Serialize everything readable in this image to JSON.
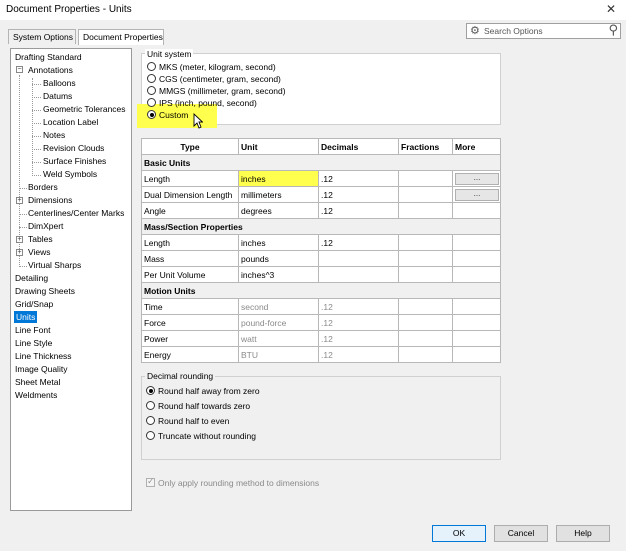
{
  "window": {
    "title": "Document Properties - Units",
    "close_glyph": "✕"
  },
  "tabs": [
    {
      "label": "System Options",
      "active": false
    },
    {
      "label": "Document Properties",
      "active": true
    }
  ],
  "search": {
    "placeholder": "Search Options",
    "icon": "gear-icon",
    "button_icon": "magnifier-icon"
  },
  "tree": {
    "items": [
      {
        "label": "Drafting Standard"
      },
      {
        "label": "Annotations",
        "expander": "−"
      },
      {
        "label": "Balloons"
      },
      {
        "label": "Datums"
      },
      {
        "label": "Geometric Tolerances"
      },
      {
        "label": "Location Label"
      },
      {
        "label": "Notes"
      },
      {
        "label": "Revision Clouds"
      },
      {
        "label": "Surface Finishes"
      },
      {
        "label": "Weld Symbols"
      },
      {
        "label": "Borders"
      },
      {
        "label": "Dimensions",
        "expander": "+"
      },
      {
        "label": "Centerlines/Center Marks"
      },
      {
        "label": "DimXpert"
      },
      {
        "label": "Tables",
        "expander": "+"
      },
      {
        "label": "Views",
        "expander": "+"
      },
      {
        "label": "Virtual Sharps"
      },
      {
        "label": "Detailing"
      },
      {
        "label": "Drawing Sheets"
      },
      {
        "label": "Grid/Snap"
      },
      {
        "label": "Units",
        "selected": true
      },
      {
        "label": "Line Font"
      },
      {
        "label": "Line Style"
      },
      {
        "label": "Line Thickness"
      },
      {
        "label": "Image Quality"
      },
      {
        "label": "Sheet Metal"
      },
      {
        "label": "Weldments"
      }
    ]
  },
  "unit_system": {
    "label": "Unit system",
    "options": [
      {
        "label": "MKS  (meter, kilogram, second)",
        "selected": false
      },
      {
        "label": "CGS  (centimeter, gram, second)",
        "selected": false
      },
      {
        "label": "MMGS  (millimeter, gram, second)",
        "selected": false
      },
      {
        "label": "IPS  (inch, pound, second)",
        "selected": false
      },
      {
        "label": "Custom",
        "selected": true
      }
    ],
    "highlight_color": "#ffff4d"
  },
  "units_table": {
    "headers": [
      "Type",
      "Unit",
      "Decimals",
      "Fractions",
      "More"
    ],
    "sections": [
      {
        "title": "Basic Units",
        "rows": [
          {
            "type": "Length",
            "unit": "inches",
            "decimals": ".12",
            "fractions": "",
            "more": "...",
            "highlight": true
          },
          {
            "type": "Dual Dimension Length",
            "unit": "millimeters",
            "decimals": ".12",
            "fractions": "",
            "more": "..."
          },
          {
            "type": "Angle",
            "unit": "degrees",
            "decimals": ".12",
            "fractions": "",
            "more": ""
          }
        ]
      },
      {
        "title": "Mass/Section Properties",
        "rows": [
          {
            "type": "Length",
            "unit": "inches",
            "decimals": ".12",
            "fractions": "",
            "more": ""
          },
          {
            "type": "Mass",
            "unit": "pounds",
            "decimals": "",
            "fractions": "",
            "more": ""
          },
          {
            "type": "Per Unit Volume",
            "unit": "inches^3",
            "decimals": "",
            "fractions": "",
            "more": ""
          }
        ]
      },
      {
        "title": "Motion Units",
        "rows": [
          {
            "type": "Time",
            "unit": "second",
            "decimals": ".12",
            "fractions": "",
            "more": "",
            "disabled": true
          },
          {
            "type": "Force",
            "unit": "pound-force",
            "decimals": ".12",
            "fractions": "",
            "more": "",
            "disabled": true
          },
          {
            "type": "Power",
            "unit": "watt",
            "decimals": ".12",
            "fractions": "",
            "more": "",
            "disabled": true
          },
          {
            "type": "Energy",
            "unit": "BTU",
            "decimals": ".12",
            "fractions": "",
            "more": "",
            "disabled": true
          }
        ]
      }
    ]
  },
  "decimal_rounding": {
    "label": "Decimal rounding",
    "options": [
      {
        "label": "Round half away from zero",
        "selected": true
      },
      {
        "label": "Round half towards zero",
        "selected": false
      },
      {
        "label": "Round half to even",
        "selected": false
      },
      {
        "label": "Truncate without rounding",
        "selected": false
      }
    ]
  },
  "only_apply": {
    "label": "Only apply rounding method to dimensions",
    "checked": true,
    "enabled": false
  },
  "buttons": {
    "ok": "OK",
    "cancel": "Cancel",
    "help": "Help"
  }
}
